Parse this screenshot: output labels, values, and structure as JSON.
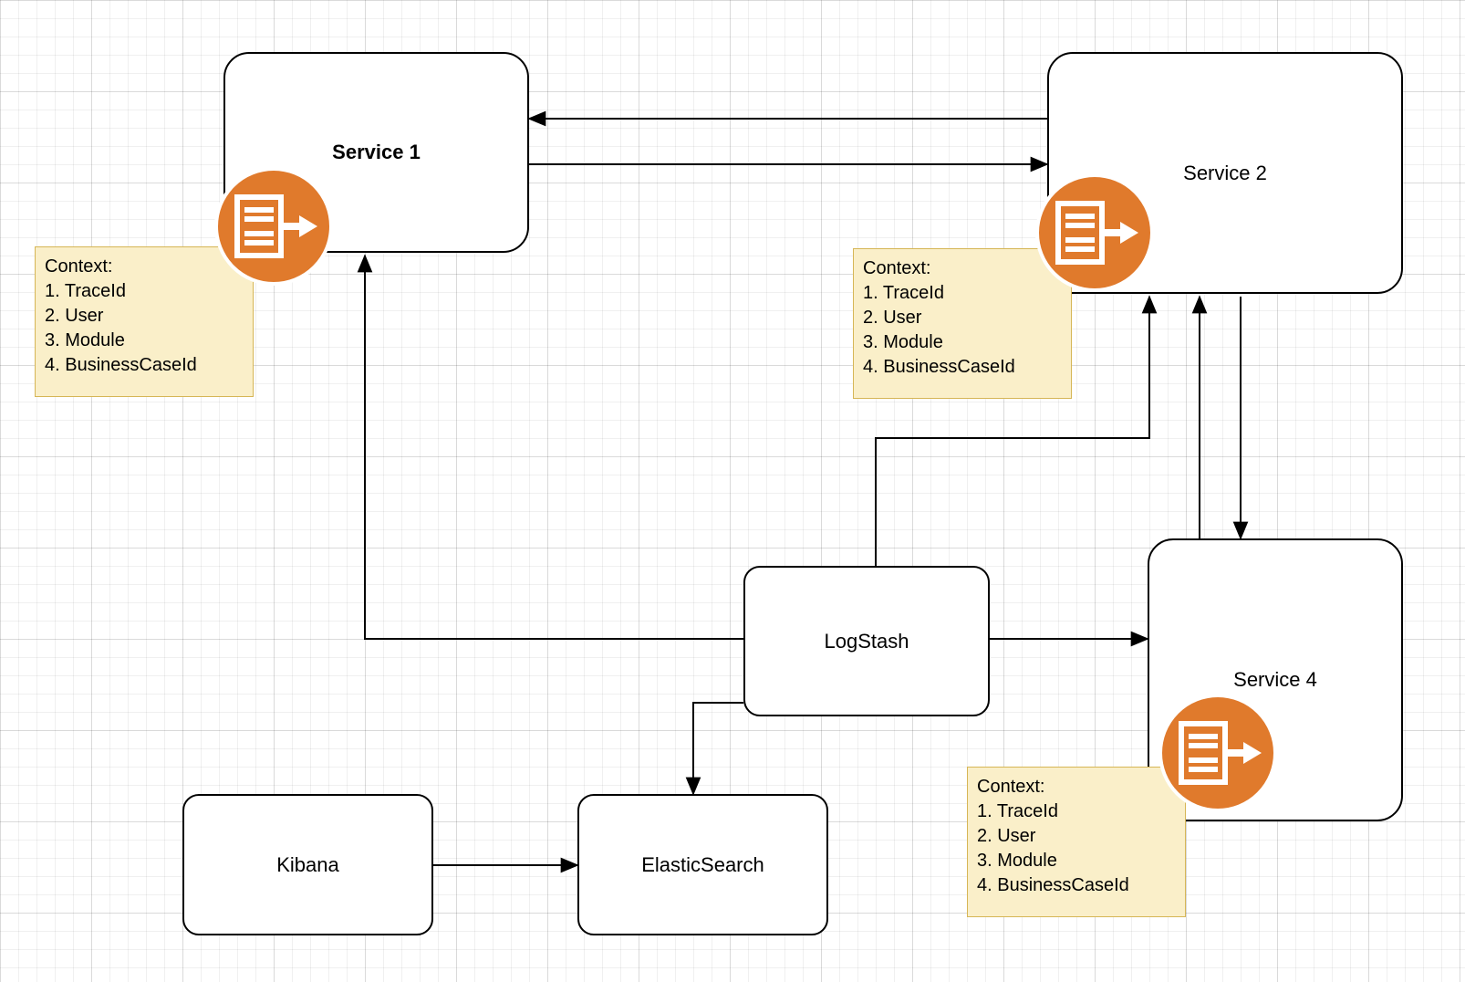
{
  "nodes": {
    "service1": {
      "label": "Service 1"
    },
    "service2": {
      "label": "Service 2"
    },
    "service4": {
      "label": "Service 4"
    },
    "logstash": {
      "label": "LogStash"
    },
    "elasticsearch": {
      "label": "ElasticSearch"
    },
    "kibana": {
      "label": "Kibana"
    }
  },
  "context_note": {
    "title": "Context:",
    "items": [
      "1. TraceId",
      "2. User",
      "3. Module",
      "4. BusinessCaseId"
    ]
  },
  "icon_name": "gateway-icon"
}
